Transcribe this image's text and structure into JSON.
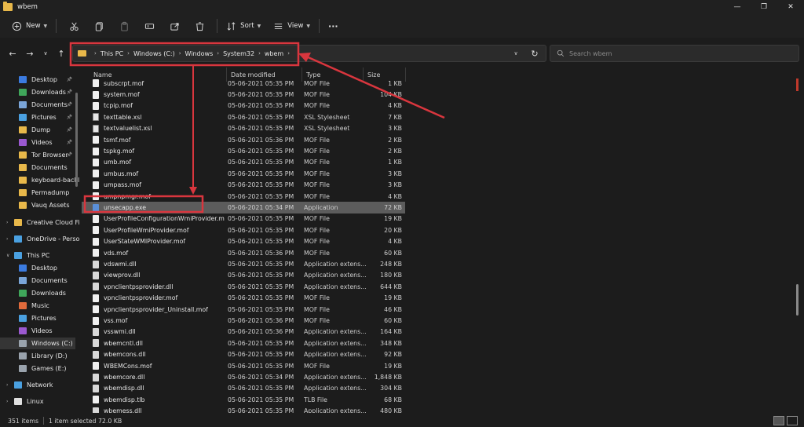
{
  "window": {
    "title": "wbem"
  },
  "toolbar": {
    "new_label": "New",
    "sort_label": "Sort",
    "view_label": "View",
    "more": "···"
  },
  "address": {
    "crumbs": [
      "This PC",
      "Windows (C:)",
      "Windows",
      "System32",
      "wbem"
    ]
  },
  "search": {
    "placeholder": "Search wbem"
  },
  "sidebar": {
    "items": [
      {
        "label": "Desktop",
        "color": "#3b7be0",
        "pinned": true
      },
      {
        "label": "Downloads",
        "color": "#3fa65a",
        "pinned": true
      },
      {
        "label": "Documents",
        "color": "#7aa5d8",
        "pinned": true
      },
      {
        "label": "Pictures",
        "color": "#4aa0e0",
        "pinned": true
      },
      {
        "label": "Dump",
        "color": "#e8b84a",
        "pinned": true
      },
      {
        "label": "Videos",
        "color": "#9b59d0",
        "pinned": true
      },
      {
        "label": "Tor Browser",
        "color": "#e8b84a",
        "pinned": true
      },
      {
        "label": "Documents",
        "color": "#e8b84a",
        "pinned": false
      },
      {
        "label": "keyboard-backli",
        "color": "#e8b84a",
        "pinned": false
      },
      {
        "label": "Permadump",
        "color": "#e8b84a",
        "pinned": false
      },
      {
        "label": "Vauq Assets",
        "color": "#e8b84a",
        "pinned": false
      },
      {
        "label": "Creative Cloud Fil",
        "color": "#e8b84a",
        "pinned": false
      },
      {
        "label": "OneDrive - Persor",
        "color": "#4aa0e0",
        "pinned": false
      },
      {
        "label": "This PC",
        "color": "#4aa0e0",
        "pinned": false
      },
      {
        "label": "Desktop",
        "color": "#3b7be0",
        "pinned": false
      },
      {
        "label": "Documents",
        "color": "#7aa5d8",
        "pinned": false
      },
      {
        "label": "Downloads",
        "color": "#3fa65a",
        "pinned": false
      },
      {
        "label": "Music",
        "color": "#e06a3b",
        "pinned": false
      },
      {
        "label": "Pictures",
        "color": "#4aa0e0",
        "pinned": false
      },
      {
        "label": "Videos",
        "color": "#9b59d0",
        "pinned": false
      },
      {
        "label": "Windows (C:)",
        "color": "#9aa3ad",
        "pinned": false
      },
      {
        "label": "Library (D:)",
        "color": "#9aa3ad",
        "pinned": false
      },
      {
        "label": "Games (E:)",
        "color": "#9aa3ad",
        "pinned": false
      },
      {
        "label": "Network",
        "color": "#4aa0e0",
        "pinned": false
      },
      {
        "label": "Linux",
        "color": "#e0e0e0",
        "pinned": false
      }
    ]
  },
  "columns": {
    "name": "Name",
    "date": "Date modified",
    "type": "Type",
    "size": "Size"
  },
  "files": [
    {
      "name": "subscrpt.mof",
      "date": "05-06-2021 05:35 PM",
      "type": "MOF File",
      "size": "1 KB",
      "kind": "mof"
    },
    {
      "name": "system.mof",
      "date": "05-06-2021 05:35 PM",
      "type": "MOF File",
      "size": "104 KB",
      "kind": "mof"
    },
    {
      "name": "tcpip.mof",
      "date": "05-06-2021 05:35 PM",
      "type": "MOF File",
      "size": "4 KB",
      "kind": "mof"
    },
    {
      "name": "texttable.xsl",
      "date": "05-06-2021 05:35 PM",
      "type": "XSL Stylesheet",
      "size": "7 KB",
      "kind": "xsl"
    },
    {
      "name": "textvaluelist.xsl",
      "date": "05-06-2021 05:35 PM",
      "type": "XSL Stylesheet",
      "size": "3 KB",
      "kind": "xsl"
    },
    {
      "name": "tsmf.mof",
      "date": "05-06-2021 05:36 PM",
      "type": "MOF File",
      "size": "2 KB",
      "kind": "mof"
    },
    {
      "name": "tspkg.mof",
      "date": "05-06-2021 05:35 PM",
      "type": "MOF File",
      "size": "2 KB",
      "kind": "mof"
    },
    {
      "name": "umb.mof",
      "date": "05-06-2021 05:35 PM",
      "type": "MOF File",
      "size": "1 KB",
      "kind": "mof"
    },
    {
      "name": "umbus.mof",
      "date": "05-06-2021 05:35 PM",
      "type": "MOF File",
      "size": "3 KB",
      "kind": "mof"
    },
    {
      "name": "umpass.mof",
      "date": "05-06-2021 05:35 PM",
      "type": "MOF File",
      "size": "3 KB",
      "kind": "mof"
    },
    {
      "name": "umpnpmgr.mof",
      "date": "05-06-2021 05:35 PM",
      "type": "MOF File",
      "size": "4 KB",
      "kind": "mof"
    },
    {
      "name": "unsecapp.exe",
      "date": "05-06-2021 05:34 PM",
      "type": "Application",
      "size": "72 KB",
      "kind": "exe",
      "selected": true
    },
    {
      "name": "UserProfileConfigurationWmiProvider.mof",
      "date": "05-06-2021 05:35 PM",
      "type": "MOF File",
      "size": "19 KB",
      "kind": "mof"
    },
    {
      "name": "UserProfileWmiProvider.mof",
      "date": "05-06-2021 05:35 PM",
      "type": "MOF File",
      "size": "20 KB",
      "kind": "mof"
    },
    {
      "name": "UserStateWMIProvider.mof",
      "date": "05-06-2021 05:35 PM",
      "type": "MOF File",
      "size": "4 KB",
      "kind": "mof"
    },
    {
      "name": "vds.mof",
      "date": "05-06-2021 05:36 PM",
      "type": "MOF File",
      "size": "60 KB",
      "kind": "mof"
    },
    {
      "name": "vdswmi.dll",
      "date": "05-06-2021 05:35 PM",
      "type": "Application extens...",
      "size": "248 KB",
      "kind": "dll"
    },
    {
      "name": "viewprov.dll",
      "date": "05-06-2021 05:35 PM",
      "type": "Application extens...",
      "size": "180 KB",
      "kind": "dll"
    },
    {
      "name": "vpnclientpsprovider.dll",
      "date": "05-06-2021 05:35 PM",
      "type": "Application extens...",
      "size": "644 KB",
      "kind": "dll"
    },
    {
      "name": "vpnclientpsprovider.mof",
      "date": "05-06-2021 05:35 PM",
      "type": "MOF File",
      "size": "19 KB",
      "kind": "mof"
    },
    {
      "name": "vpnclientpsprovider_Uninstall.mof",
      "date": "05-06-2021 05:35 PM",
      "type": "MOF File",
      "size": "46 KB",
      "kind": "mof"
    },
    {
      "name": "vss.mof",
      "date": "05-06-2021 05:36 PM",
      "type": "MOF File",
      "size": "60 KB",
      "kind": "mof"
    },
    {
      "name": "vsswmi.dll",
      "date": "05-06-2021 05:36 PM",
      "type": "Application extens...",
      "size": "164 KB",
      "kind": "dll"
    },
    {
      "name": "wbemcntl.dll",
      "date": "05-06-2021 05:35 PM",
      "type": "Application extens...",
      "size": "348 KB",
      "kind": "dll"
    },
    {
      "name": "wbemcons.dll",
      "date": "05-06-2021 05:35 PM",
      "type": "Application extens...",
      "size": "92 KB",
      "kind": "dll"
    },
    {
      "name": "WBEMCons.mof",
      "date": "05-06-2021 05:35 PM",
      "type": "MOF File",
      "size": "19 KB",
      "kind": "mof"
    },
    {
      "name": "wbemcore.dll",
      "date": "05-06-2021 05:34 PM",
      "type": "Application extens...",
      "size": "1,848 KB",
      "kind": "dll"
    },
    {
      "name": "wbemdisp.dll",
      "date": "05-06-2021 05:35 PM",
      "type": "Application extens...",
      "size": "304 KB",
      "kind": "dll"
    },
    {
      "name": "wbemdisp.tlb",
      "date": "05-06-2021 05:35 PM",
      "type": "TLB File",
      "size": "68 KB",
      "kind": "mof"
    },
    {
      "name": "wbemess.dll",
      "date": "05-06-2021 05:35 PM",
      "type": "Application extens...",
      "size": "480 KB",
      "kind": "dll"
    }
  ],
  "status": {
    "count": "351 items",
    "selected": "1 item selected  72.0 KB"
  },
  "annotation_color": "#d9363e"
}
